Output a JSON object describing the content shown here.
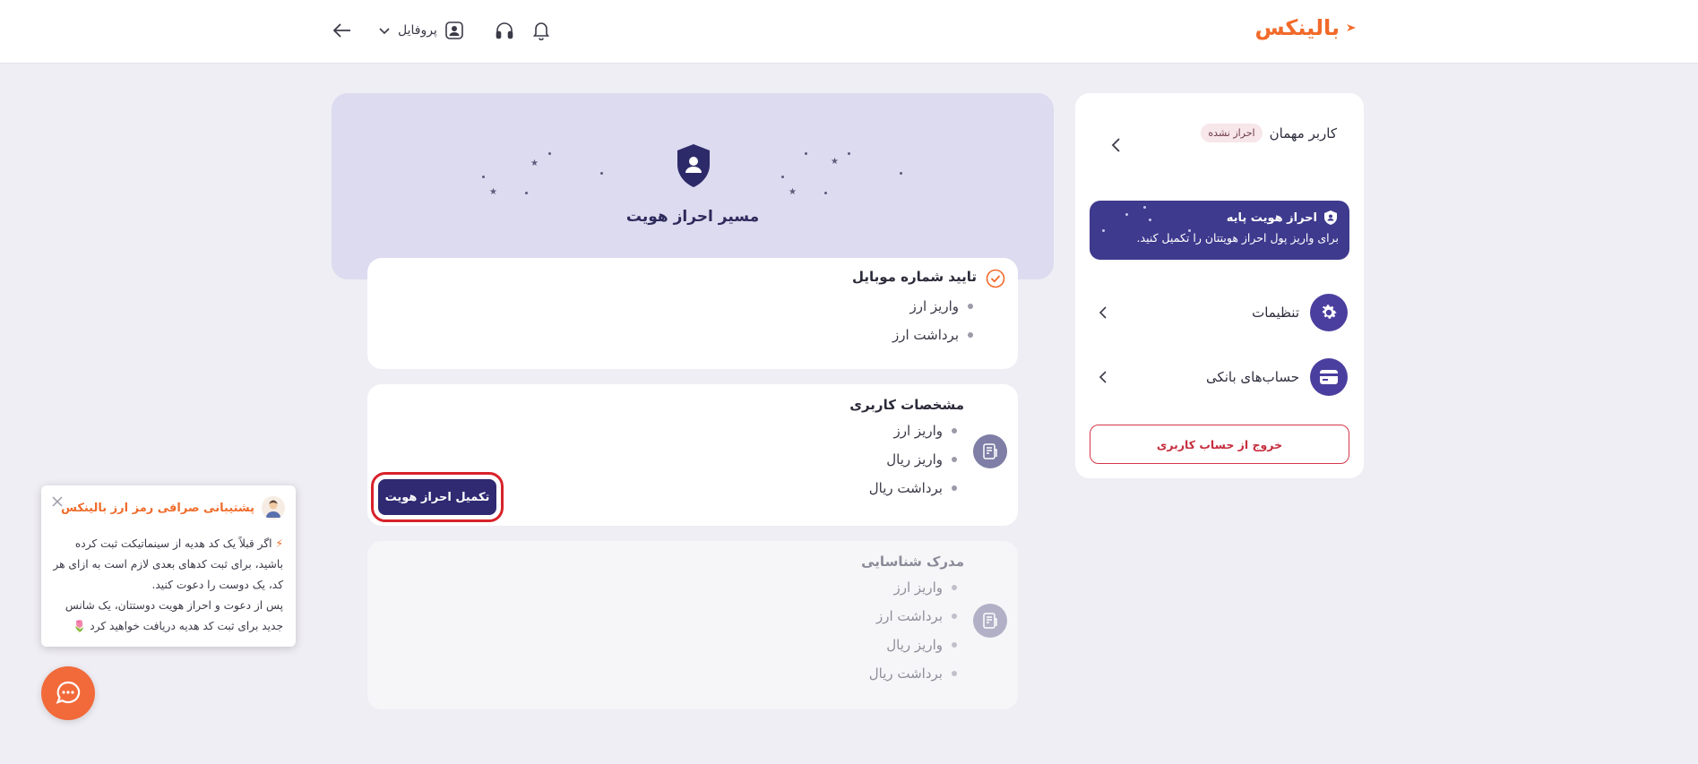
{
  "header": {
    "logo_text": "بالینکس",
    "profile_label": "پروفایل",
    "icons": [
      "bell-icon",
      "headphones-icon",
      "user-icon",
      "chevron-down-icon",
      "arrow-left-icon"
    ]
  },
  "sidebar": {
    "user_name": "کاربر مهمان",
    "user_status": "احراز نشده",
    "kyc_banner": {
      "title": "احراز هویت پایه",
      "description": "برای واریز پول احراز هویتتان را تکمیل کنید."
    },
    "menu": [
      {
        "label": "تنظیمات",
        "icon": "gear-icon"
      },
      {
        "label": "حساب‌های بانکی",
        "icon": "card-icon"
      }
    ],
    "logout_label": "خروج از حساب کاربری"
  },
  "hero": {
    "title": "مسیر احراز هویت"
  },
  "steps": [
    {
      "title": "تایید شماره موبایل",
      "status": "completed",
      "items": [
        "واریز ارز",
        "برداشت ارز"
      ]
    },
    {
      "title": "مشخصات کاربری",
      "status": "current",
      "items": [
        "واریز ارز",
        "واریز ریال",
        "برداشت ریال"
      ],
      "action_label": "تکمیل احراز هویت"
    },
    {
      "title": "مدرک شناسایی",
      "status": "locked",
      "items": [
        "واریز ارز",
        "برداشت ارز",
        "واریز ریال",
        "برداشت ریال"
      ]
    }
  ],
  "support": {
    "title": "پشتیبانی صرافی رمز ارز بالینکس",
    "line1": "اگر قبلاً یک کد هدیه از سینماتیکت ثبت کرده باشید، برای ثبت کدهای بعدی لازم است به ازای هر کد، یک دوست را دعوت کنید.",
    "line2": "پس از دعوت و احراز هویت دوستتان، یک شانس جدید برای ثبت کد هدیه دریافت خواهید کرد",
    "bolt_glyph": "⚡",
    "flower_glyph": "🌷"
  },
  "colors": {
    "brand_orange": "#f26a2a",
    "primary_purple": "#3e3a8e",
    "danger_red": "#d43848"
  }
}
